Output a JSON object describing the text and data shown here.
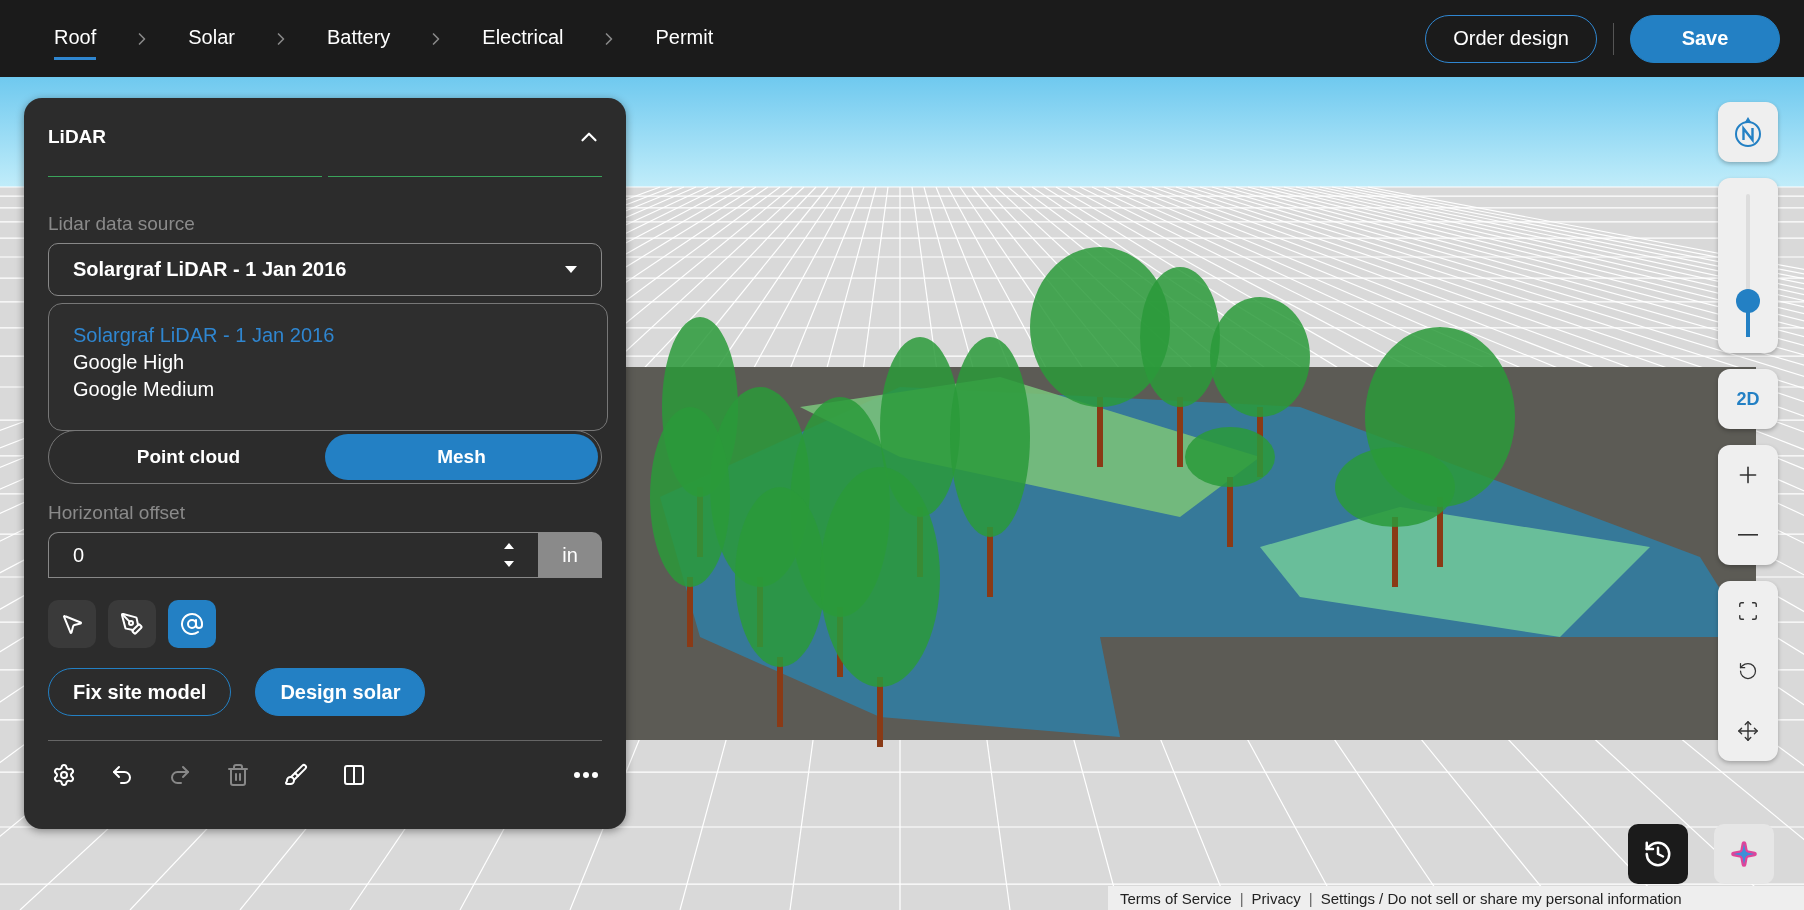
{
  "steps": [
    {
      "label": "Roof",
      "selected": true
    },
    {
      "label": "Solar",
      "selected": false
    },
    {
      "label": "Battery",
      "selected": false
    },
    {
      "label": "Electrical",
      "selected": false
    },
    {
      "label": "Permit",
      "selected": false
    }
  ],
  "header_buttons": [
    {
      "label": "Order design",
      "kind": "outline"
    },
    {
      "label": "Save",
      "kind": "primary"
    }
  ],
  "panel": {
    "title": "LiDAR",
    "expanded": true,
    "source_label": "Lidar data source",
    "source_value": "Solargraf LiDAR - 1 Jan 2016",
    "source_options": [
      {
        "label": "Solargraf LiDAR - 1 Jan 2016",
        "selected": true
      },
      {
        "label": "Google High",
        "selected": false
      },
      {
        "label": "Google Medium",
        "selected": false
      }
    ],
    "view_modes": [
      {
        "label": "Point cloud",
        "selected": false
      },
      {
        "label": "Mesh",
        "selected": true
      }
    ],
    "offset_label": "Horizontal offset",
    "offset_value": "0",
    "offset_unit": "in",
    "tools": [
      {
        "kind": "select",
        "selected": false
      },
      {
        "kind": "pen",
        "selected": false
      },
      {
        "kind": "target",
        "selected": true
      }
    ],
    "actions": [
      {
        "label": "Fix site model",
        "kind": "outline"
      },
      {
        "label": "Design solar",
        "kind": "primary"
      }
    ],
    "bottom_tools": [
      {
        "kind": "settings",
        "disabled": false
      },
      {
        "kind": "undo",
        "disabled": false
      },
      {
        "kind": "redo",
        "disabled": true
      },
      {
        "kind": "delete",
        "disabled": true
      },
      {
        "kind": "clean",
        "disabled": false
      },
      {
        "kind": "split",
        "disabled": false
      },
      {
        "kind": "more",
        "disabled": false
      }
    ]
  },
  "map_controls": {
    "tilt": {
      "level": 0.25
    },
    "mode_label": "2D"
  },
  "footer_items": [
    {
      "kind": "link",
      "label": "Terms of Service"
    },
    {
      "kind": "separator",
      "label": "|"
    },
    {
      "kind": "link",
      "label": "Privacy"
    },
    {
      "kind": "separator",
      "label": "|"
    },
    {
      "kind": "link",
      "label": "Settings / Do not sell or share my personal information"
    }
  ]
}
